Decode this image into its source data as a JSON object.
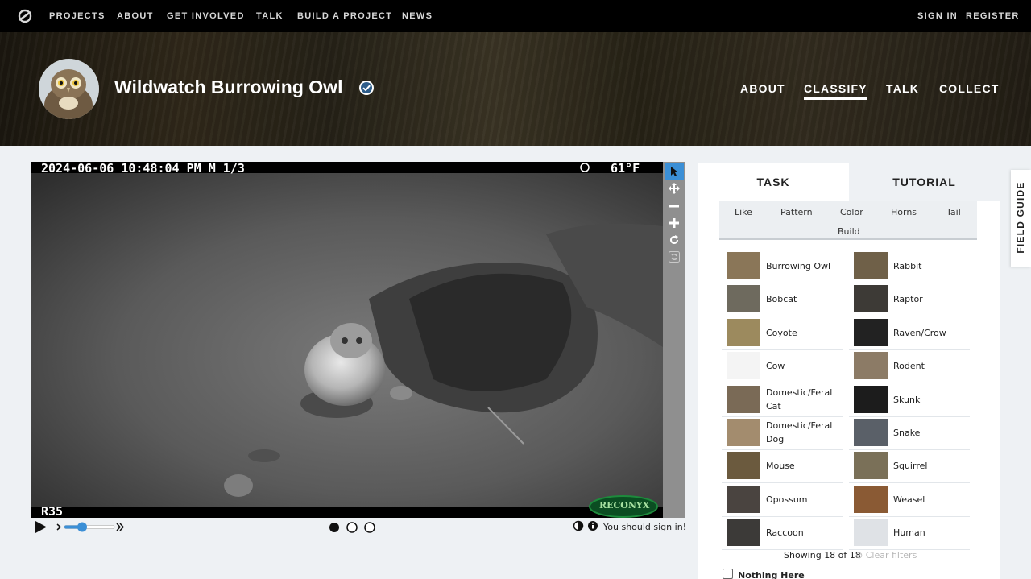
{
  "nav": {
    "links": [
      "PROJECTS",
      "ABOUT",
      "GET INVOLVED",
      "TALK",
      "BUILD A PROJECT",
      "NEWS"
    ],
    "sign_in": "SIGN IN",
    "register": "REGISTER"
  },
  "project": {
    "title": "Wildwatch Burrowing Owl",
    "links": [
      "ABOUT",
      "CLASSIFY",
      "TALK",
      "COLLECT"
    ],
    "active_link": "CLASSIFY"
  },
  "subject": {
    "timestamp": "2024-06-06 10:48:04 PM  M 1/3",
    "temperature": "61°F",
    "camera_id": "R35",
    "brand": "RECONYX",
    "frame_count": 3,
    "current_frame": 1,
    "sign_in_message": "You should sign in!"
  },
  "task_panel": {
    "tabs": [
      "TASK",
      "TUTORIAL"
    ],
    "filters": [
      "Like",
      "Pattern",
      "Color",
      "Horns",
      "Tail",
      "Build"
    ],
    "choices": [
      {
        "label": "Burrowing Owl"
      },
      {
        "label": "Rabbit"
      },
      {
        "label": "Bobcat"
      },
      {
        "label": "Raptor"
      },
      {
        "label": "Coyote"
      },
      {
        "label": "Raven/Crow"
      },
      {
        "label": "Cow"
      },
      {
        "label": "Rodent"
      },
      {
        "label": "Domestic/Feral Cat"
      },
      {
        "label": "Skunk"
      },
      {
        "label": "Domestic/Feral Dog"
      },
      {
        "label": "Snake"
      },
      {
        "label": "Mouse"
      },
      {
        "label": "Squirrel"
      },
      {
        "label": "Opossum"
      },
      {
        "label": "Weasel"
      },
      {
        "label": "Raccoon"
      },
      {
        "label": "Human"
      }
    ],
    "showing": "Showing 18 of 18",
    "clear_filters": "Clear filters",
    "nothing_here": "Nothing Here"
  },
  "field_guide": "FIELD GUIDE",
  "colors": {
    "accent": "#3b8fd6",
    "nav_bg": "#000000",
    "page_bg": "#eef1f4"
  }
}
